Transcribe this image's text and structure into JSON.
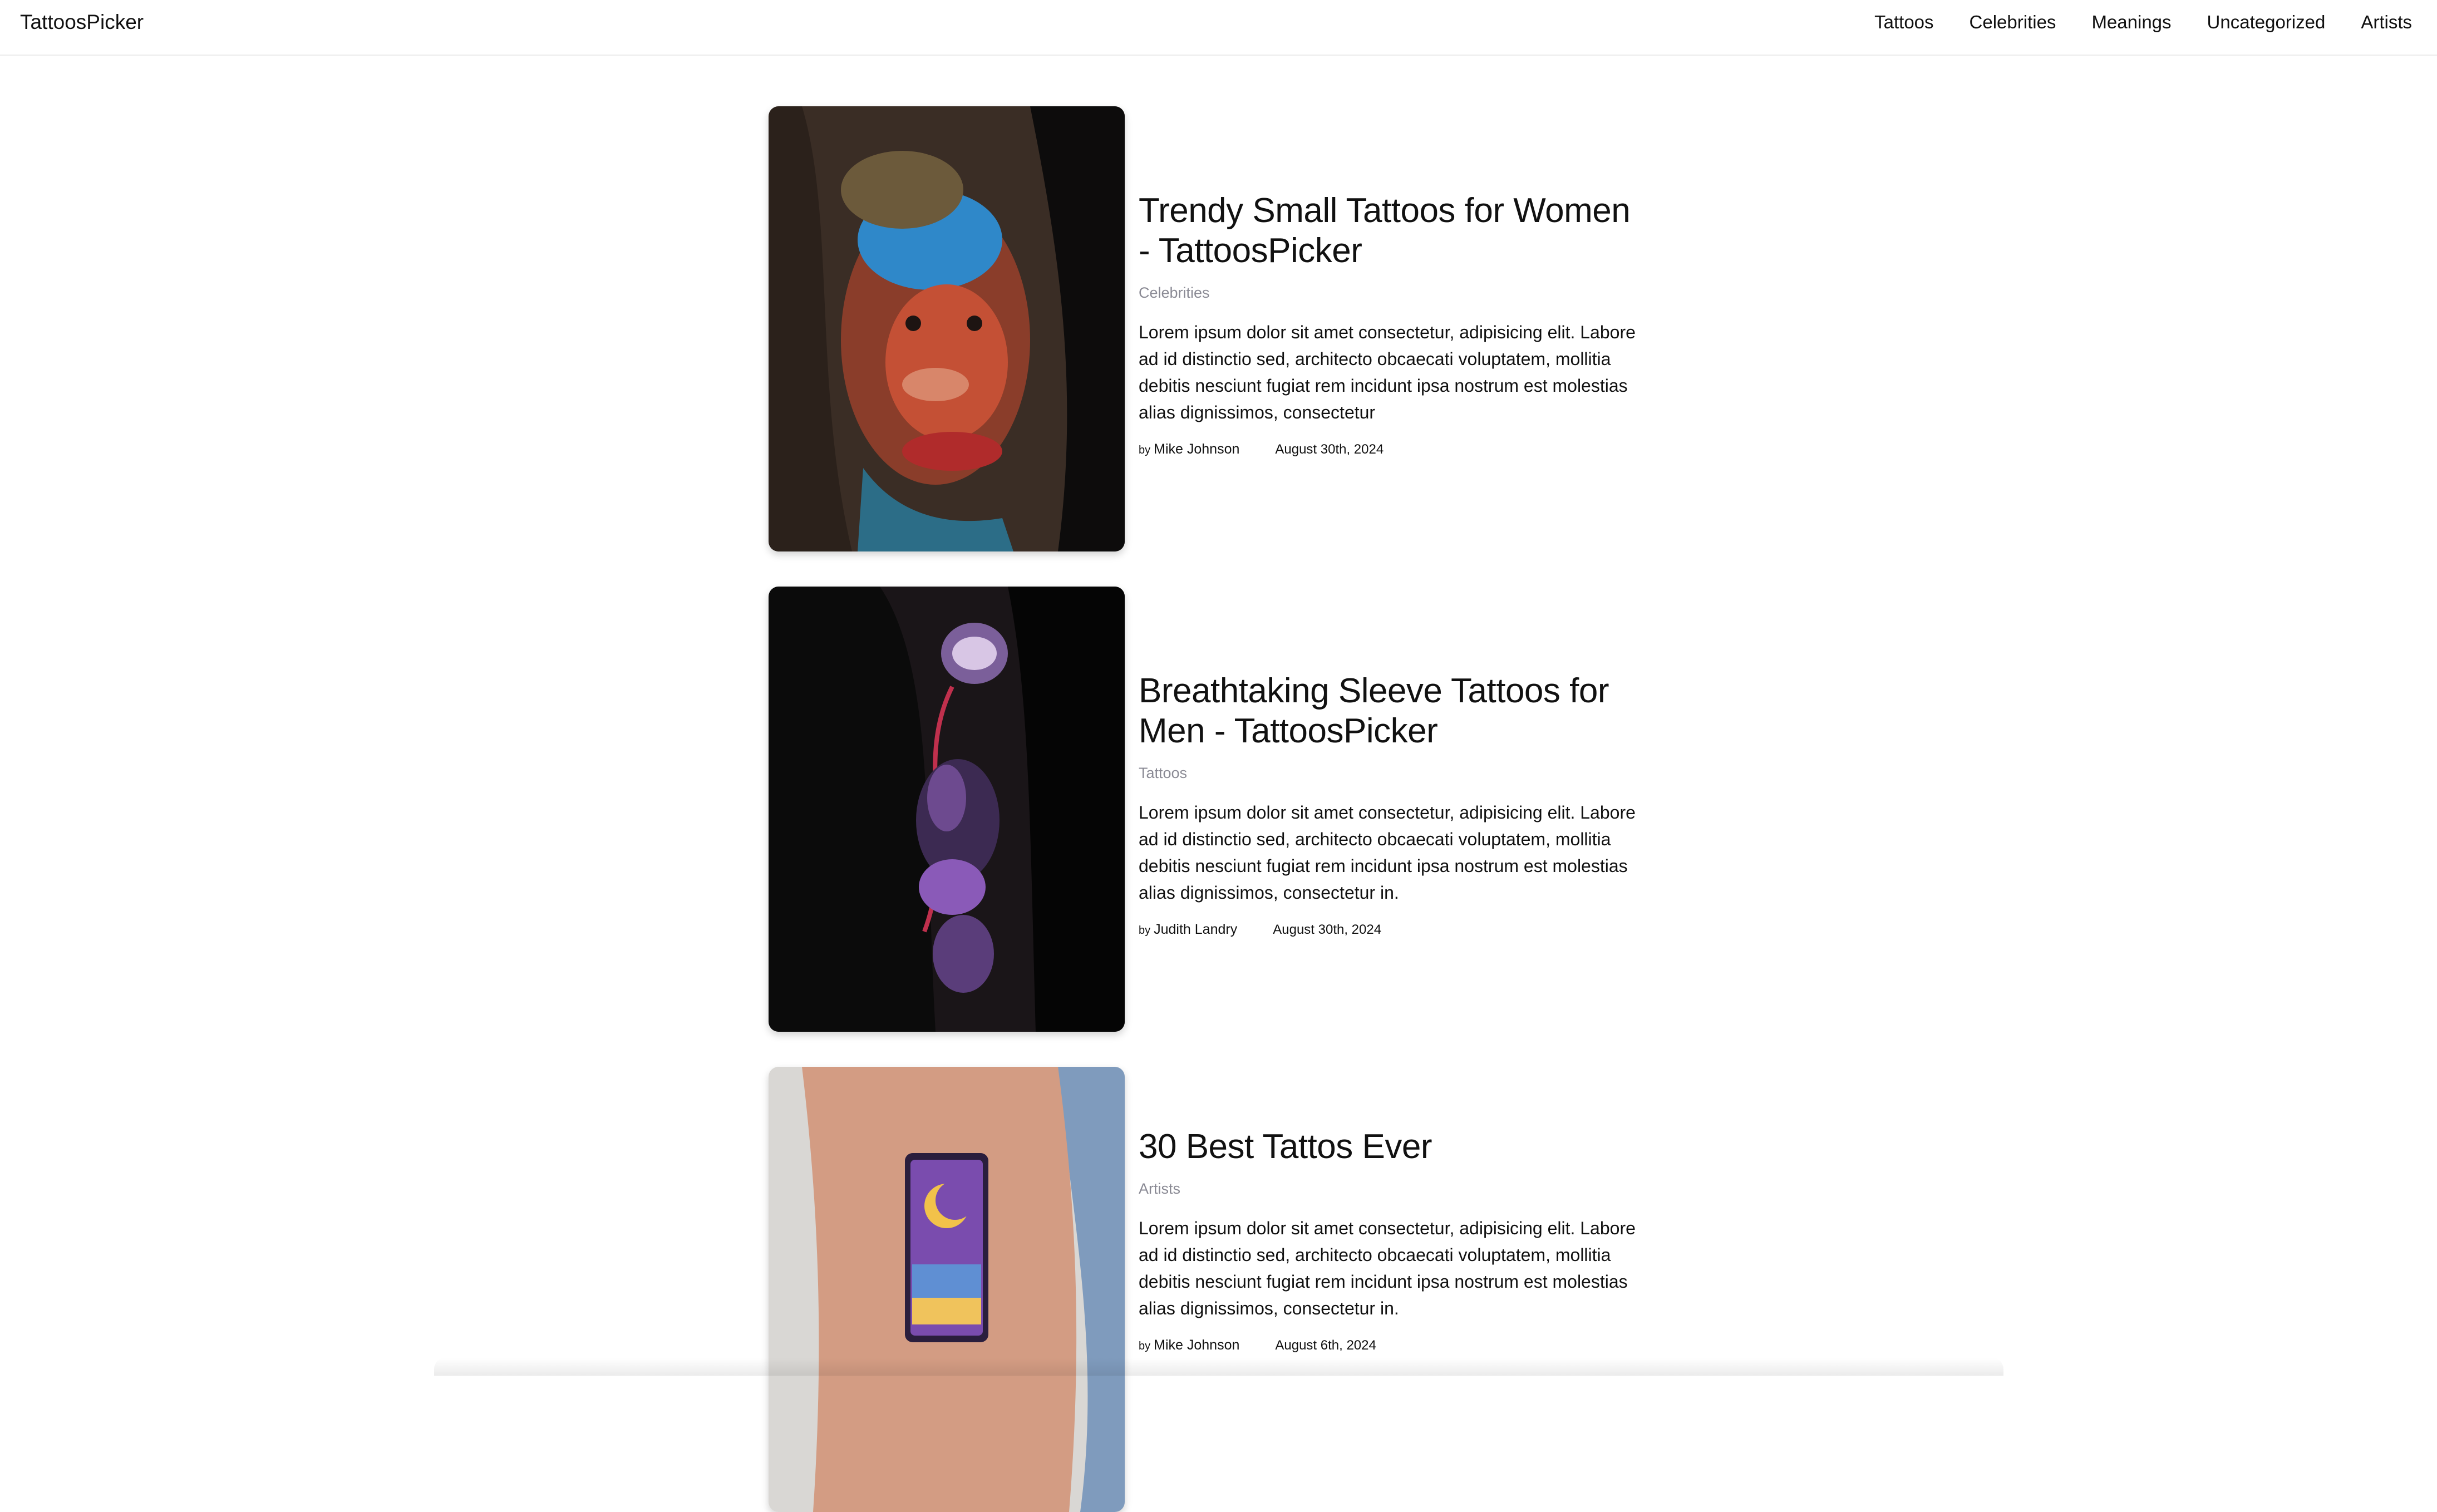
{
  "site": {
    "brand": "TattoosPicker"
  },
  "nav": {
    "items": [
      {
        "label": "Tattoos"
      },
      {
        "label": "Celebrities"
      },
      {
        "label": "Meanings"
      },
      {
        "label": "Uncategorized"
      },
      {
        "label": "Artists"
      }
    ]
  },
  "posts": [
    {
      "title": "Trendy Small Tattoos for Women - TattoosPicker",
      "category": "Celebrities",
      "excerpt": "Lorem ipsum dolor sit amet consectetur, adipisicing elit. Labore ad id distinctio sed, architecto obcaecati voluptatem, mollitia debitis nesciunt fugiat rem incidunt ipsa nostrum est molestias alias dignissimos, consectetur",
      "by": "by",
      "author": "Mike Johnson",
      "date": "August 30th, 2024"
    },
    {
      "title": "Breathtaking Sleeve Tattoos for Men - TattoosPicker",
      "category": "Tattoos",
      "excerpt": "Lorem ipsum dolor sit amet consectetur, adipisicing elit. Labore ad id distinctio sed, architecto obcaecati voluptatem, mollitia debitis nesciunt fugiat rem incidunt ipsa nostrum est molestias alias dignissimos, consectetur in.",
      "by": "by",
      "author": "Judith Landry",
      "date": "August 30th, 2024"
    },
    {
      "title": "30 Best Tattos Ever",
      "category": "Artists",
      "excerpt": "Lorem ipsum dolor sit amet consectetur, adipisicing elit. Labore ad id distinctio sed, architecto obcaecati voluptatem, mollitia debitis nesciunt fugiat rem incidunt ipsa nostrum est molestias alias dignissimos, consectetur in.",
      "by": "by",
      "author": "Mike Johnson",
      "date": "August 6th, 2024"
    }
  ]
}
